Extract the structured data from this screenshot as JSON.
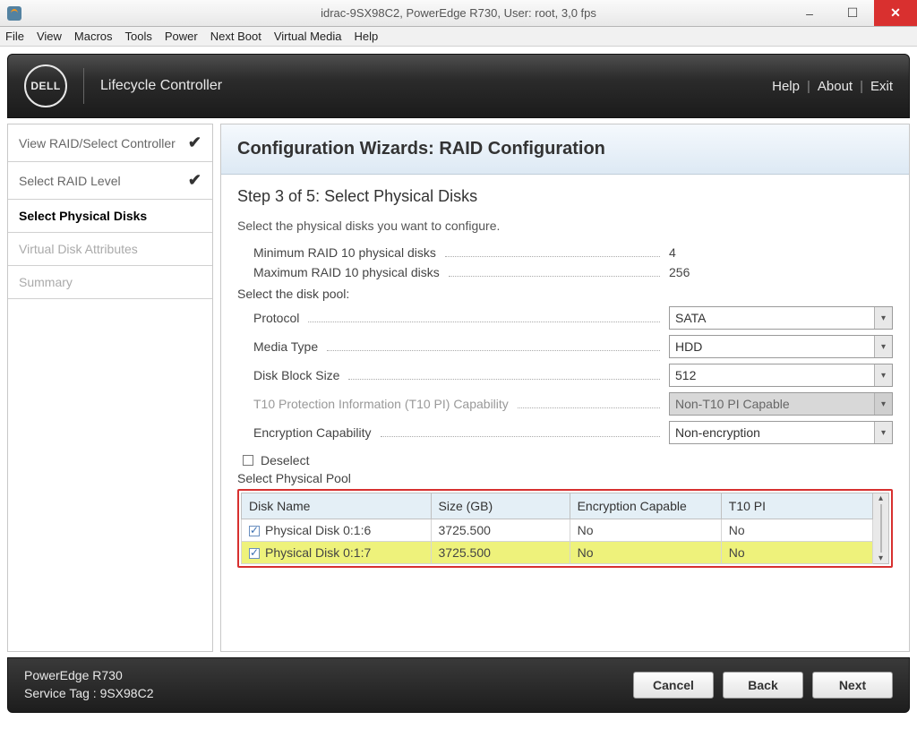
{
  "window": {
    "title": "idrac-9SX98C2, PowerEdge R730, User: root, 3,0 fps"
  },
  "win_buttons": {
    "min": "–",
    "max": "☐",
    "close": "✕"
  },
  "menubar": [
    "File",
    "View",
    "Macros",
    "Tools",
    "Power",
    "Next Boot",
    "Virtual Media",
    "Help"
  ],
  "header": {
    "brand": "DELL",
    "product": "Lifecycle Controller",
    "links": {
      "help": "Help",
      "about": "About",
      "exit": "Exit"
    }
  },
  "sidebar": [
    {
      "label": "View RAID/Select Controller",
      "state": "done",
      "check": true
    },
    {
      "label": "Select RAID Level",
      "state": "done",
      "check": true
    },
    {
      "label": "Select Physical Disks",
      "state": "current",
      "check": false
    },
    {
      "label": "Virtual Disk Attributes",
      "state": "future",
      "check": false
    },
    {
      "label": "Summary",
      "state": "future",
      "check": false
    }
  ],
  "panel": {
    "title": "Configuration Wizards: RAID Configuration",
    "step": "Step 3 of 5: Select Physical Disks",
    "desc": "Select the physical disks you want to configure.",
    "min_label": "Minimum RAID 10 physical disks",
    "min_val": "4",
    "max_label": "Maximum RAID 10 physical disks",
    "max_val": "256",
    "pool_label": "Select the disk pool:",
    "selects": {
      "protocol": {
        "label": "Protocol",
        "value": "SATA",
        "disabled": false
      },
      "media": {
        "label": "Media Type",
        "value": "HDD",
        "disabled": false
      },
      "block": {
        "label": "Disk Block Size",
        "value": "512",
        "disabled": false
      },
      "t10": {
        "label": "T10 Protection Information (T10 PI) Capability",
        "value": "Non-T10 PI Capable",
        "disabled": true
      },
      "encrypt": {
        "label": "Encryption Capability",
        "value": "Non-encryption",
        "disabled": false
      }
    },
    "deselect_label": "Deselect",
    "pool_table_label": "Select Physical Pool",
    "columns": {
      "name": "Disk Name",
      "size": "Size (GB)",
      "enc": "Encryption Capable",
      "t10": "T10 PI"
    },
    "rows": [
      {
        "name": "Physical Disk 0:1:6",
        "size": "3725.500",
        "enc": "No",
        "t10": "No",
        "checked": true,
        "selected": false
      },
      {
        "name": "Physical Disk 0:1:7",
        "size": "3725.500",
        "enc": "No",
        "t10": "No",
        "checked": true,
        "selected": true
      }
    ]
  },
  "footer": {
    "model": "PowerEdge R730",
    "service_tag_label": "Service Tag :",
    "service_tag": "9SX98C2",
    "cancel": "Cancel",
    "back": "Back",
    "next": "Next"
  }
}
